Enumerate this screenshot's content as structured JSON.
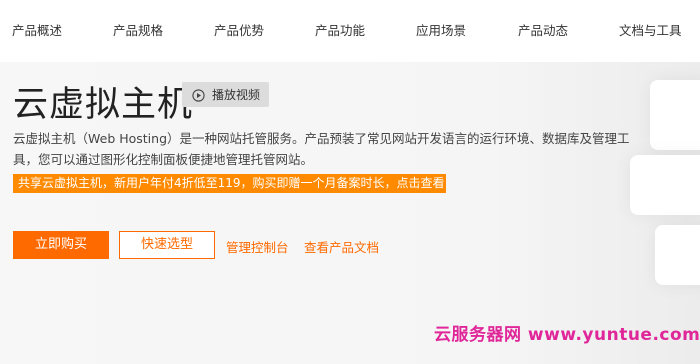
{
  "nav": {
    "items": [
      "产品概述",
      "产品规格",
      "产品优势",
      "产品功能",
      "应用场景",
      "产品动态",
      "文档与工具"
    ]
  },
  "hero": {
    "title": "云虚拟主机",
    "video_label": "播放视频",
    "description": "云虚拟主机（Web Hosting）是一种网站托管服务。产品预装了常见网站开发语言的运行环境、数据库及管理工具，您可以通过图形化控制面板便捷地管理托管网站。",
    "promo": "共享云虚拟主机，新用户年付4折低至119，购买即赠一个月备案时长，点击查看",
    "buy_label": "立即购买",
    "select_label": "快速选型",
    "console_label": "管理控制台",
    "docs_label": "查看产品文档"
  },
  "watermark": "云服务器网 www.yuntue.com",
  "colors": {
    "accent": "#ff6a00",
    "promo_bg": "#ff8a00",
    "watermark": "#e0279a"
  }
}
